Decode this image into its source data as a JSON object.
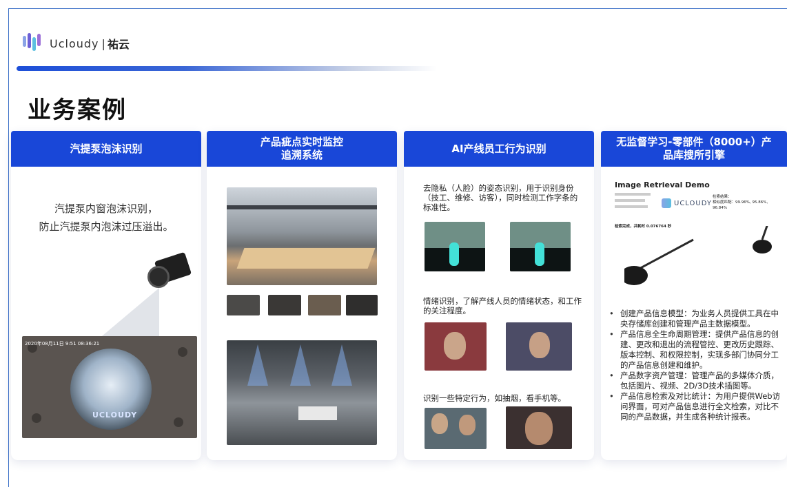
{
  "brand": {
    "name": "Ucloudy",
    "name_cn": "祐云",
    "divider": "|"
  },
  "page_title": "业务案例",
  "cards": [
    {
      "title": "汽提泵泡沫识别",
      "description_line1": "汽提泵内窗泡沫识别，",
      "description_line2": "防止汽提泵内泡沫过压溢出。",
      "photo_timestamp": "2020年08月11日 9:51 08:36:21",
      "photo_watermark": "UCLOUDY"
    },
    {
      "title_line1": "产品疵点实时监控",
      "title_line2": "追溯系统"
    },
    {
      "title": "AI产线员工行为识别",
      "text1": "去隐私（人脸）的姿态识别，用于识别身份（技工、维修、访客），同时检测工作字条的标准性。",
      "text2": "情绪识别，了解产线人员的情绪状态，和工作的关注程度。",
      "text3": "识别一些特定行为，如抽烟，看手机等。"
    },
    {
      "title_line1": "无监督学习-零部件（8000+）产",
      "title_line2": "品库搜所引擎",
      "demo_title": "Image Retrieval Demo",
      "demo_result_label": "检索结果：",
      "demo_similarity": "相似度匹配：99.96%, 95.86%, 96.84%",
      "demo_time": "检索完成，共耗时 0.076764 秒",
      "demo_logo": "UCLOUDY",
      "bullets": [
        "创建产品信息模型：为业务人员提供工具在中央存储库创建和管理产品主数据模型。",
        "产品信息全生命周期管理：提供产品信息的创建、更改和退出的流程管控、更改历史跟踪、版本控制、和权限控制，实现多部门协同分工的产品信息创建和维护。",
        "产品数字资产管理：管理产品的多媒体介质，包括图片、视频、2D/3D技术插图等。",
        "产品信息检索及对比统计：为用户提供Web访问界面，可对产品信息进行全文检索，对比不同的产品数据，并生成各种统计报表。"
      ]
    }
  ]
}
